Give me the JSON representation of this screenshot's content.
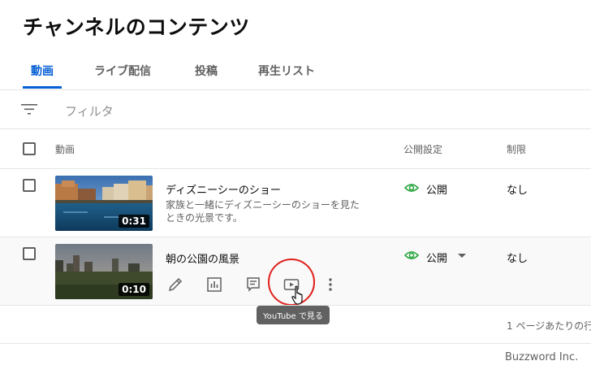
{
  "page": {
    "title": "チャンネルのコンテンツ"
  },
  "tabs": [
    {
      "label": "動画",
      "active": true
    },
    {
      "label": "ライブ配信",
      "active": false
    },
    {
      "label": "投稿",
      "active": false
    },
    {
      "label": "再生リスト",
      "active": false
    }
  ],
  "filter": {
    "placeholder": "フィルタ",
    "icon": "filter-icon"
  },
  "table": {
    "headers": {
      "video": "動画",
      "visibility": "公開設定",
      "restrictions": "制限"
    },
    "rows": [
      {
        "title": "ディズニーシーのショー",
        "description_line1": "家族と一緒にディズニーシーのショーを見た",
        "description_line2": "ときの光景です。",
        "duration": "0:31",
        "visibility": "公開",
        "restrictions": "なし"
      },
      {
        "title": "朝の公園の風景",
        "duration": "0:10",
        "visibility": "公開",
        "restrictions": "なし",
        "actions": [
          "pencil-icon",
          "analytics-icon",
          "comments-icon",
          "youtube-play-icon",
          "more-vert-icon"
        ]
      }
    ]
  },
  "tooltip": {
    "text": "YouTube で見る"
  },
  "pagination": {
    "rows_per_page_label": "1 ページあたりの行"
  },
  "footer": {
    "credit": "Buzzword Inc."
  },
  "colors": {
    "accent": "#065fd4",
    "visibility_green": "#2ba640",
    "highlight_red": "#e0201c"
  }
}
